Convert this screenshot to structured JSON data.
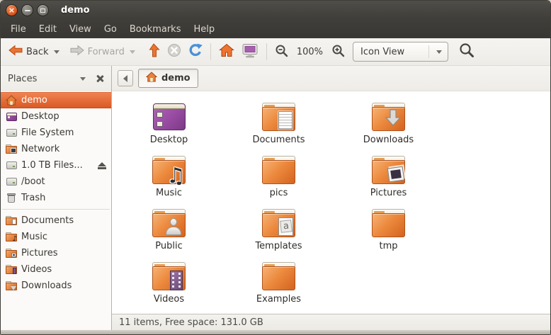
{
  "window": {
    "title": "demo"
  },
  "menubar": {
    "items": [
      {
        "label": "File"
      },
      {
        "label": "Edit"
      },
      {
        "label": "View"
      },
      {
        "label": "Go"
      },
      {
        "label": "Bookmarks"
      },
      {
        "label": "Help"
      }
    ]
  },
  "toolbar": {
    "back_label": "Back",
    "forward_label": "Forward",
    "zoom_level": "100%",
    "view_mode": "Icon View"
  },
  "pathbar": {
    "crumb_label": "demo"
  },
  "sidebar": {
    "header": "Places",
    "items": [
      {
        "label": "demo",
        "icon": "home-folder",
        "selected": true
      },
      {
        "label": "Desktop",
        "icon": "desktop"
      },
      {
        "label": "File System",
        "icon": "drive"
      },
      {
        "label": "Network",
        "icon": "network"
      },
      {
        "label": "1.0 TB Files...",
        "icon": "drive",
        "eject": true
      },
      {
        "label": "/boot",
        "icon": "drive"
      },
      {
        "label": "Trash",
        "icon": "trash"
      }
    ],
    "bookmarks": [
      {
        "label": "Documents",
        "icon": "folder-documents"
      },
      {
        "label": "Music",
        "icon": "folder-music"
      },
      {
        "label": "Pictures",
        "icon": "folder-pictures"
      },
      {
        "label": "Videos",
        "icon": "folder-videos"
      },
      {
        "label": "Downloads",
        "icon": "folder-downloads"
      }
    ]
  },
  "files": [
    {
      "label": "Desktop",
      "icon": "desktop"
    },
    {
      "label": "Documents",
      "icon": "folder-documents"
    },
    {
      "label": "Downloads",
      "icon": "folder-downloads"
    },
    {
      "label": "Music",
      "icon": "folder-music"
    },
    {
      "label": "pics",
      "icon": "folder-plain"
    },
    {
      "label": "Pictures",
      "icon": "folder-pictures"
    },
    {
      "label": "Public",
      "icon": "folder-public"
    },
    {
      "label": "Templates",
      "icon": "folder-templates"
    },
    {
      "label": "tmp",
      "icon": "folder-plain"
    },
    {
      "label": "Videos",
      "icon": "folder-videos"
    },
    {
      "label": "Examples",
      "icon": "folder-plain"
    }
  ],
  "statusbar": {
    "text": "11 items, Free space: 131.0 GB"
  },
  "colors": {
    "selection_orange": "#DD5B24",
    "folder_orange": "#E8823A",
    "titlebar_dark": "#403E3A",
    "refresh_blue": "#4A90D9",
    "desktop_purple": "#9A4DA4"
  }
}
